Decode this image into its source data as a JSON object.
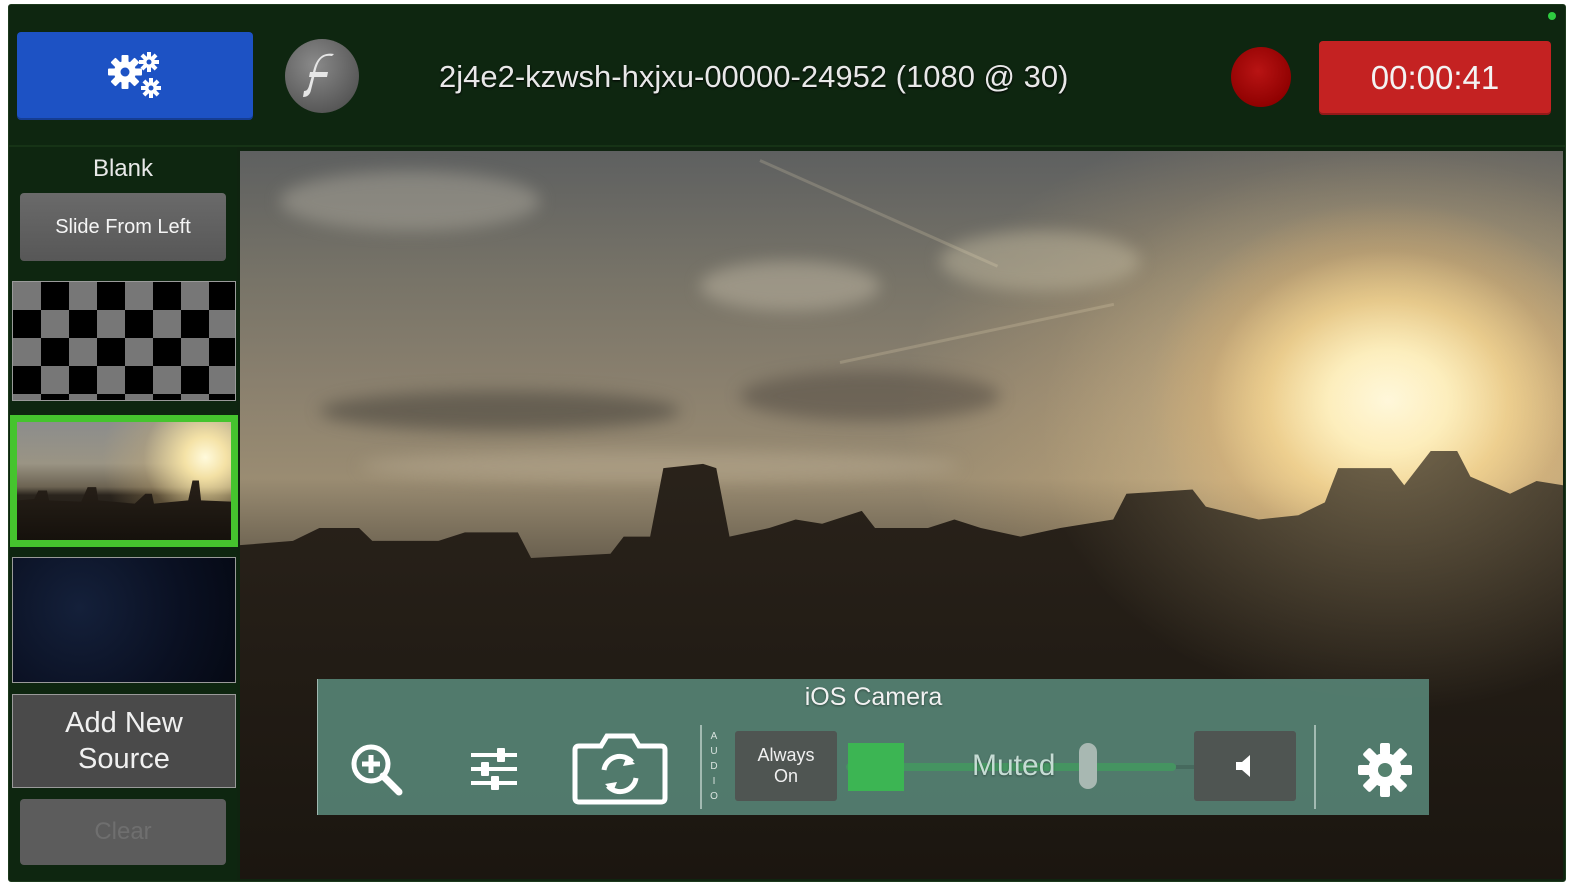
{
  "topbar": {
    "stream_name": "2j4e2-kzwsh-hxjxu-00000-24952  (1080 @ 30)",
    "timer": "00:00:41",
    "settings_icon": "gears-icon",
    "logo_icon": "flash-logo-icon",
    "record_color": "#9e0000",
    "settings_color": "#1d52c4",
    "timer_color": "#c42222"
  },
  "sidebar": {
    "blank_label": "Blank",
    "transition_label": "Slide From Left",
    "add_source_line1": "Add New",
    "add_source_line2": "Source",
    "clear_label": "Clear",
    "selected_color": "#45c42e"
  },
  "source_panel": {
    "title": "iOS Camera",
    "audio_label": "A\nU\nD\nI\nO",
    "always_on_line1": "Always",
    "always_on_line2": "On",
    "muted_label": "Muted"
  }
}
